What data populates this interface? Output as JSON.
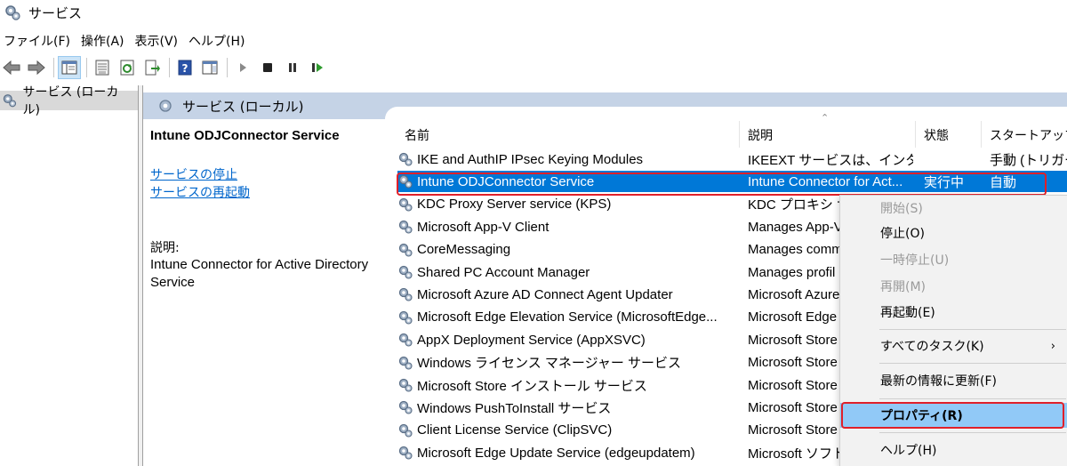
{
  "window": {
    "title": "サービス"
  },
  "menubar": [
    "ファイル(F)",
    "操作(A)",
    "表示(V)",
    "ヘルプ(H)"
  ],
  "toolbar": {
    "icons": [
      "back-icon",
      "forward-icon",
      "show-hide-tree-icon",
      "properties-icon",
      "refresh-icon",
      "export-list-icon",
      "help-icon",
      "show-action-pane-icon",
      "start-service-icon",
      "stop-service-icon",
      "pause-service-icon",
      "restart-service-icon"
    ]
  },
  "tree": {
    "root_label": "サービス (ローカル)"
  },
  "pane": {
    "header_title": "サービス (ローカル)",
    "selected_service_name": "Intune ODJConnector Service",
    "link_stop": "サービスの停止",
    "link_restart": "サービスの再起動",
    "description_label": "説明:",
    "description_text": "Intune Connector for Active Directory Service"
  },
  "table": {
    "columns": [
      "名前",
      "説明",
      "状態",
      "スタートアップの"
    ],
    "rows": [
      {
        "name": "IKE and AuthIP IPsec Keying Modules",
        "desc": "IKEEXT サービスは、インター...",
        "state": "",
        "startup": "手動 (トリガー開"
      },
      {
        "name": "Intune ODJConnector Service",
        "desc": "Intune Connector for Act...",
        "state": "実行中",
        "startup": "自動"
      },
      {
        "name": "KDC Proxy Server service (KPS)",
        "desc": "KDC プロキシ サー",
        "state": "",
        "startup": ""
      },
      {
        "name": "Microsoft App-V Client",
        "desc": "Manages App-V",
        "state": "",
        "startup": ""
      },
      {
        "name": "CoreMessaging",
        "desc": "Manages comm",
        "state": "",
        "startup": ""
      },
      {
        "name": "Shared PC Account Manager",
        "desc": "Manages profil",
        "state": "",
        "startup": ""
      },
      {
        "name": "Microsoft Azure AD Connect Agent Updater",
        "desc": "Microsoft Azure",
        "state": "",
        "startup": ""
      },
      {
        "name": "Microsoft Edge Elevation Service (MicrosoftEdge...",
        "desc": "Microsoft Edge",
        "state": "",
        "startup": ""
      },
      {
        "name": "AppX Deployment Service (AppXSVC)",
        "desc": "Microsoft Store",
        "state": "",
        "startup": ""
      },
      {
        "name": "Windows ライセンス マネージャー サービス",
        "desc": "Microsoft Store",
        "state": "",
        "startup": ""
      },
      {
        "name": "Microsoft Store インストール サービス",
        "desc": "Microsoft Store",
        "state": "",
        "startup": ""
      },
      {
        "name": "Windows PushToInstall サービス",
        "desc": "Microsoft Store",
        "state": "",
        "startup": ""
      },
      {
        "name": "Client License Service (ClipSVC)",
        "desc": "Microsoft Store",
        "state": "",
        "startup": ""
      },
      {
        "name": "Microsoft Edge Update Service (edgeupdatem)",
        "desc": "Microsoft ソフト",
        "state": "",
        "startup": ""
      }
    ],
    "selected_index": 1
  },
  "context_menu": {
    "items": {
      "start": "開始(S)",
      "stop": "停止(O)",
      "pause": "一時停止(U)",
      "resume": "再開(M)",
      "restart": "再起動(E)",
      "all_tasks": "すべてのタスク(K)",
      "refresh": "最新の情報に更新(F)",
      "properties": "プロパティ(R)",
      "help": "ヘルプ(H)"
    },
    "submenu_arrow": "›"
  },
  "colors": {
    "selection": "#0078d7",
    "header_band": "#c5d3e6",
    "highlight_outline": "#e0202a",
    "menu_hover": "#91c9f7"
  }
}
